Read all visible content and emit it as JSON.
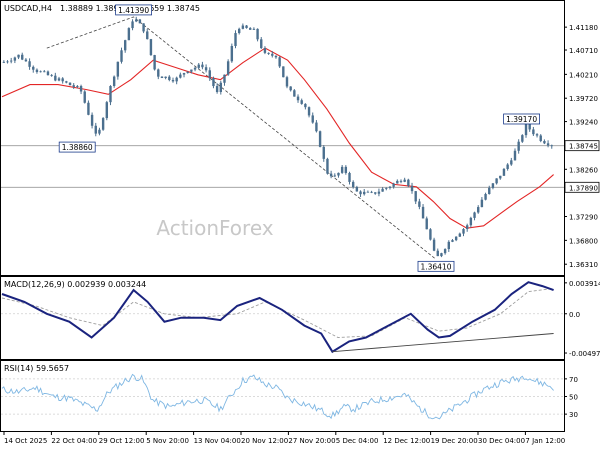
{
  "header": {
    "symbol_tf": "USDCAD,H4",
    "ohlc": "1.38889 1.38926 1.38659 1.38745"
  },
  "watermark": "ActionForex",
  "colors": {
    "candle": "#4b6f8e",
    "ma": "#e32626",
    "macd": "#1a237e",
    "signal": "#9e9e9e",
    "rsi": "#7fb7e3",
    "trend": "#444444",
    "grid": "#cfcfcf",
    "label_box": "#1a3a8a"
  },
  "chart_data": [
    {
      "type": "candlestick",
      "title": "USDCAD,H4",
      "y_ticks": [
        "1.41180",
        "1.40710",
        "1.40210",
        "1.39720",
        "1.39240",
        "1.38745",
        "1.38260",
        "1.37890",
        "1.37290",
        "1.36800",
        "1.36310"
      ],
      "ylim": [
        1.3615,
        1.4145
      ],
      "x_ticks": [
        "14 Oct 2025",
        "22 Oct 04:00",
        "29 Oct 12:00",
        "5 Nov 20:00",
        "13 Nov 04:00",
        "20 Nov 12:00",
        "27 Nov 20:00",
        "5 Dec 04:00",
        "12 Dec 12:00",
        "19 Dec 20:00",
        "30 Dec 04:00",
        "7 Jan 12:00"
      ],
      "price_path": [
        [
          0,
          1.4045
        ],
        [
          0.03,
          1.406
        ],
        [
          0.06,
          1.403
        ],
        [
          0.1,
          1.401
        ],
        [
          0.14,
          1.399
        ],
        [
          0.17,
          1.3886
        ],
        [
          0.19,
          1.398
        ],
        [
          0.21,
          1.406
        ],
        [
          0.235,
          1.4139
        ],
        [
          0.255,
          1.411
        ],
        [
          0.275,
          1.402
        ],
        [
          0.31,
          1.401
        ],
        [
          0.33,
          1.403
        ],
        [
          0.36,
          1.404
        ],
        [
          0.385,
          1.398
        ],
        [
          0.4,
          1.403
        ],
        [
          0.42,
          1.412
        ],
        [
          0.45,
          1.411
        ],
        [
          0.47,
          1.406
        ],
        [
          0.49,
          1.406
        ],
        [
          0.51,
          1.399
        ],
        [
          0.54,
          1.396
        ],
        [
          0.565,
          1.389
        ],
        [
          0.58,
          1.382
        ],
        [
          0.595,
          1.381
        ],
        [
          0.61,
          1.383
        ],
        [
          0.63,
          1.378
        ],
        [
          0.66,
          1.3775
        ],
        [
          0.69,
          1.379
        ],
        [
          0.72,
          1.381
        ],
        [
          0.74,
          1.376
        ],
        [
          0.76,
          1.37
        ],
        [
          0.775,
          1.3641
        ],
        [
          0.8,
          1.368
        ],
        [
          0.83,
          1.371
        ],
        [
          0.86,
          1.377
        ],
        [
          0.88,
          1.38
        ],
        [
          0.9,
          1.383
        ],
        [
          0.92,
          1.387
        ],
        [
          0.935,
          1.3917
        ],
        [
          0.95,
          1.39
        ],
        [
          0.965,
          1.3885
        ],
        [
          0.985,
          1.3875
        ]
      ],
      "ma_path": [
        [
          0,
          1.3975
        ],
        [
          0.05,
          1.4
        ],
        [
          0.1,
          1.4
        ],
        [
          0.15,
          1.399
        ],
        [
          0.19,
          1.398
        ],
        [
          0.23,
          1.401
        ],
        [
          0.27,
          1.405
        ],
        [
          0.31,
          1.4035
        ],
        [
          0.35,
          1.402
        ],
        [
          0.39,
          1.401
        ],
        [
          0.43,
          1.4045
        ],
        [
          0.47,
          1.4075
        ],
        [
          0.51,
          1.405
        ],
        [
          0.54,
          1.401
        ],
        [
          0.58,
          1.395
        ],
        [
          0.62,
          1.388
        ],
        [
          0.66,
          1.382
        ],
        [
          0.7,
          1.3795
        ],
        [
          0.74,
          1.379
        ],
        [
          0.77,
          1.376
        ],
        [
          0.8,
          1.3725
        ],
        [
          0.83,
          1.3705
        ],
        [
          0.86,
          1.371
        ],
        [
          0.89,
          1.3735
        ],
        [
          0.92,
          1.376
        ],
        [
          0.96,
          1.379
        ],
        [
          0.985,
          1.3815
        ]
      ],
      "trendline": [
        [
          0.08,
          1.4075
        ],
        [
          0.235,
          1.4139
        ],
        [
          0.775,
          1.3641
        ]
      ],
      "hline_levels": [
        1.38745,
        1.3789
      ],
      "labels": [
        {
          "text": "1.41390",
          "x": 0.235,
          "y": 1.4139
        },
        {
          "text": "1.38860",
          "x": 0.17,
          "y": 1.3886
        },
        {
          "text": "1.36410",
          "x": 0.775,
          "y": 1.3641
        },
        {
          "text": "1.39170",
          "x": 0.935,
          "y": 1.3917
        }
      ],
      "current_price_label": "1.38745",
      "level_label": "1.37890"
    },
    {
      "type": "line",
      "title": "MACD(12,26,9) 0.002939 0.003244",
      "y_ticks": [
        "0.003914",
        "0.0",
        "-0.00497"
      ],
      "ylim": [
        -0.0056,
        0.0044
      ],
      "series": [
        {
          "name": "MACD",
          "values": [
            [
              0,
              0.0025
            ],
            [
              0.04,
              0.0015
            ],
            [
              0.08,
              0.0
            ],
            [
              0.12,
              -0.001
            ],
            [
              0.16,
              -0.003
            ],
            [
              0.2,
              -0.0005
            ],
            [
              0.235,
              0.003
            ],
            [
              0.26,
              0.0015
            ],
            [
              0.29,
              -0.001
            ],
            [
              0.32,
              -0.0005
            ],
            [
              0.36,
              -0.0005
            ],
            [
              0.39,
              -0.0008
            ],
            [
              0.42,
              0.001
            ],
            [
              0.46,
              0.002
            ],
            [
              0.5,
              0.0005
            ],
            [
              0.54,
              -0.0015
            ],
            [
              0.57,
              -0.0025
            ],
            [
              0.59,
              -0.0048
            ],
            [
              0.62,
              -0.0035
            ],
            [
              0.65,
              -0.003
            ],
            [
              0.69,
              -0.0015
            ],
            [
              0.73,
              0.0
            ],
            [
              0.76,
              -0.002
            ],
            [
              0.78,
              -0.003
            ],
            [
              0.8,
              -0.0028
            ],
            [
              0.84,
              -0.001
            ],
            [
              0.88,
              0.0005
            ],
            [
              0.91,
              0.0025
            ],
            [
              0.94,
              0.004
            ],
            [
              0.965,
              0.0035
            ],
            [
              0.985,
              0.003
            ]
          ]
        },
        {
          "name": "Signal",
          "values": [
            [
              0,
              0.002
            ],
            [
              0.06,
              0.001
            ],
            [
              0.12,
              -0.0005
            ],
            [
              0.18,
              -0.0015
            ],
            [
              0.235,
              0.0015
            ],
            [
              0.29,
              0.0
            ],
            [
              0.35,
              -0.0005
            ],
            [
              0.42,
              0.0
            ],
            [
              0.47,
              0.0015
            ],
            [
              0.54,
              -0.0008
            ],
            [
              0.6,
              -0.003
            ],
            [
              0.66,
              -0.0028
            ],
            [
              0.72,
              -0.0005
            ],
            [
              0.78,
              -0.0022
            ],
            [
              0.83,
              -0.0018
            ],
            [
              0.89,
              0.0
            ],
            [
              0.94,
              0.0028
            ],
            [
              0.985,
              0.0032
            ]
          ]
        }
      ],
      "trendline": [
        [
          0.59,
          -0.0048
        ],
        [
          0.985,
          -0.0025
        ]
      ]
    },
    {
      "type": "line",
      "title": "RSI(14) 59.5657",
      "y_ticks": [
        "70",
        "50",
        "30"
      ],
      "ylim": [
        12,
        88
      ],
      "series": [
        {
          "name": "RSI",
          "values": [
            [
              0,
              58
            ],
            [
              0.03,
              55
            ],
            [
              0.06,
              60
            ],
            [
              0.09,
              50
            ],
            [
              0.12,
              48
            ],
            [
              0.15,
              40
            ],
            [
              0.17,
              35
            ],
            [
              0.19,
              55
            ],
            [
              0.22,
              68
            ],
            [
              0.235,
              73
            ],
            [
              0.25,
              70
            ],
            [
              0.27,
              45
            ],
            [
              0.3,
              38
            ],
            [
              0.33,
              44
            ],
            [
              0.36,
              46
            ],
            [
              0.39,
              36
            ],
            [
              0.41,
              52
            ],
            [
              0.43,
              68
            ],
            [
              0.45,
              72
            ],
            [
              0.47,
              64
            ],
            [
              0.49,
              60
            ],
            [
              0.51,
              48
            ],
            [
              0.54,
              42
            ],
            [
              0.57,
              34
            ],
            [
              0.59,
              28
            ],
            [
              0.61,
              38
            ],
            [
              0.63,
              36
            ],
            [
              0.66,
              44
            ],
            [
              0.69,
              48
            ],
            [
              0.72,
              52
            ],
            [
              0.74,
              40
            ],
            [
              0.76,
              30
            ],
            [
              0.78,
              26
            ],
            [
              0.8,
              34
            ],
            [
              0.83,
              46
            ],
            [
              0.86,
              58
            ],
            [
              0.89,
              66
            ],
            [
              0.92,
              70
            ],
            [
              0.935,
              74
            ],
            [
              0.95,
              68
            ],
            [
              0.97,
              64
            ],
            [
              0.985,
              60
            ]
          ]
        }
      ]
    }
  ]
}
